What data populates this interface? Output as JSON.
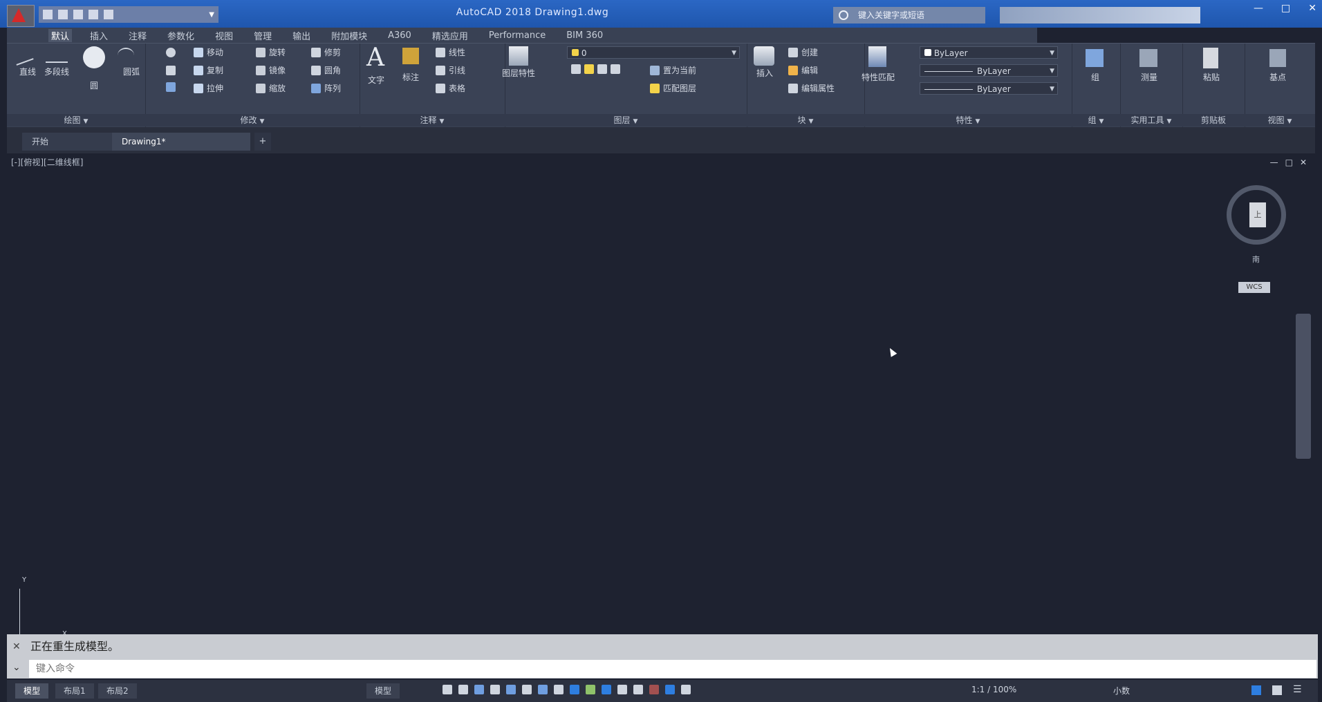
{
  "title_bar": {
    "document_title": "AutoCAD 2018  Drawing1.dwg",
    "search_placeholder": "键入关键字或短语",
    "window_controls": [
      "—",
      "□",
      "✕"
    ]
  },
  "menu_tabs": [
    {
      "label": "默认",
      "active": true
    },
    {
      "label": "插入",
      "active": false
    },
    {
      "label": "注释",
      "active": false
    },
    {
      "label": "参数化",
      "active": false
    },
    {
      "label": "视图",
      "active": false
    },
    {
      "label": "管理",
      "active": false
    },
    {
      "label": "输出",
      "active": false
    },
    {
      "label": "附加模块",
      "active": false
    },
    {
      "label": "A360",
      "active": false
    },
    {
      "label": "精选应用",
      "active": false
    },
    {
      "label": "Performance",
      "active": false
    },
    {
      "label": "BIM 360",
      "active": false
    }
  ],
  "ribbon": {
    "draw": {
      "title": "绘图",
      "line": "直线",
      "polyline": "多段线",
      "circle": "圆",
      "arc": "圆弧"
    },
    "modify": {
      "title": "修改",
      "items": [
        "移动",
        "旋转",
        "修剪",
        "复制",
        "镜像",
        "圆角",
        "拉伸",
        "缩放",
        "阵列"
      ]
    },
    "annotation": {
      "title": "注释",
      "text": "文字",
      "dimension": "标注",
      "linear": "线性",
      "leader": "引线",
      "table": "表格"
    },
    "layers": {
      "title": "图层",
      "layer_properties": "图层特性",
      "make_current": "置为当前",
      "match_layer": "匹配图层",
      "current_layer": "0"
    },
    "block": {
      "title": "块",
      "insert": "插入",
      "create": "创建",
      "edit": "编辑",
      "edit_attributes": "编辑属性"
    },
    "properties": {
      "title": "特性",
      "match_properties": "特性匹配",
      "color": "ByLayer",
      "linetype": "ByLayer",
      "lineweight": "ByLayer"
    },
    "groups": {
      "title": "组",
      "group": "组"
    },
    "utilities": {
      "title": "实用工具",
      "measure": "测量"
    },
    "clipboard": {
      "title": "剪贴板",
      "paste": "粘贴"
    },
    "view": {
      "title": "视图",
      "base": "基点"
    }
  },
  "file_tabs": [
    {
      "label": "开始",
      "active": false
    },
    {
      "label": "Drawing1*",
      "active": true
    }
  ],
  "viewport": {
    "label": "[-][俯视][二维线框]",
    "controls": [
      "—",
      "□",
      "✕"
    ],
    "viewcube_face": "上",
    "compass_south": "南",
    "wcs": "WCS",
    "ucs_y": "Y",
    "ucs_x": "X"
  },
  "command_line": {
    "history": "正在重生成模型。",
    "placeholder": "键入命令"
  },
  "status_bar": {
    "layout_tabs": [
      {
        "label": "模型",
        "active": true
      },
      {
        "label": "布局1",
        "active": false
      },
      {
        "label": "布局2",
        "active": false
      }
    ],
    "model_label": "模型",
    "annotation_scale": "1:1 / 100%",
    "units": "小数"
  },
  "colors": {
    "accent": "#2b67c4",
    "canvas": "#1e2230",
    "ribbon": "#3a4255",
    "autocad_red": "#d42a2a"
  }
}
